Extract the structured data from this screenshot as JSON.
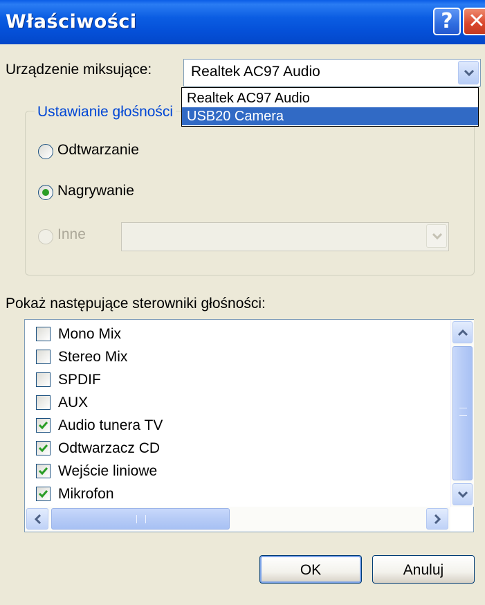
{
  "window": {
    "title": "Właściwości"
  },
  "titlebar": {
    "help_glyph": "?",
    "close_glyph": "✕"
  },
  "mixer": {
    "label": "Urządzenie miksujące:",
    "selected": "Realtek AC97 Audio",
    "options": [
      "Realtek AC97 Audio",
      "USB20 Camera"
    ],
    "highlighted_option": "USB20 Camera"
  },
  "volume_group": {
    "title": "Ustawianie głośności",
    "options": [
      {
        "label": "Odtwarzanie",
        "checked": false,
        "enabled": true
      },
      {
        "label": "Nagrywanie",
        "checked": true,
        "enabled": true
      },
      {
        "label": "Inne",
        "checked": false,
        "enabled": false
      }
    ],
    "inne_value": ""
  },
  "controls": {
    "label": "Pokaż następujące sterowniki głośności:",
    "items": [
      {
        "label": "Mono Mix",
        "checked": false
      },
      {
        "label": "Stereo Mix",
        "checked": false
      },
      {
        "label": "SPDIF",
        "checked": false
      },
      {
        "label": "AUX",
        "checked": false
      },
      {
        "label": "Audio tunera TV",
        "checked": true
      },
      {
        "label": "Odtwarzacz CD",
        "checked": true
      },
      {
        "label": "Wejście liniowe",
        "checked": true
      },
      {
        "label": "Mikrofon",
        "checked": true
      }
    ]
  },
  "buttons": {
    "ok": "OK",
    "cancel": "Anuluj"
  },
  "colors": {
    "title_bar": "#0550d8",
    "selection": "#316ac5",
    "check": "#2a9d26",
    "group_title": "#0046d5"
  }
}
